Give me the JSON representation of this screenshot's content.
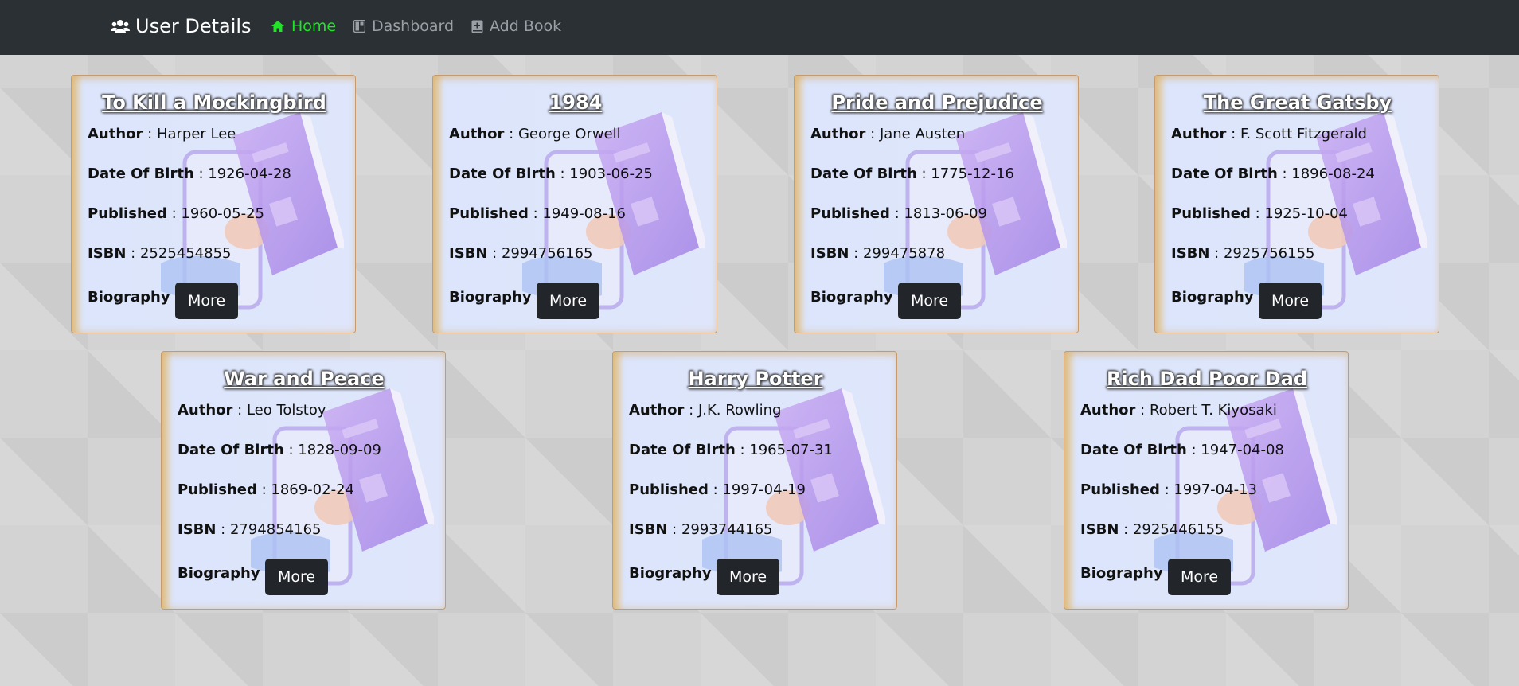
{
  "navbar": {
    "brand": "User Details",
    "links": [
      {
        "label": "Home",
        "icon": "home-icon",
        "active": true
      },
      {
        "label": "Dashboard",
        "icon": "dashboard-icon",
        "active": false
      },
      {
        "label": "Add Book",
        "icon": "add-book-icon",
        "active": false
      }
    ]
  },
  "labels": {
    "author": "Author",
    "dob": "Date Of Birth",
    "published": "Published",
    "isbn": "ISBN",
    "biography": "Biography",
    "more": "More"
  },
  "books": [
    {
      "title": "To Kill a Mockingbird",
      "author": "Harper Lee",
      "dob": "1926-04-28",
      "published": "1960-05-25",
      "isbn": "2525454855"
    },
    {
      "title": "1984",
      "author": "George Orwell",
      "dob": "1903-06-25",
      "published": "1949-08-16",
      "isbn": "2994756165"
    },
    {
      "title": "Pride and Prejudice",
      "author": "Jane Austen",
      "dob": "1775-12-16",
      "published": "1813-06-09",
      "isbn": "299475878"
    },
    {
      "title": "The Great Gatsby",
      "author": "F. Scott Fitzgerald",
      "dob": "1896-08-24",
      "published": "1925-10-04",
      "isbn": "2925756155"
    },
    {
      "title": "War and Peace",
      "author": "Leo Tolstoy",
      "dob": "1828-09-09",
      "published": "1869-02-24",
      "isbn": "2794854165"
    },
    {
      "title": "Harry Potter",
      "author": "J.K. Rowling",
      "dob": "1965-07-31",
      "published": "1997-04-19",
      "isbn": "2993744165"
    },
    {
      "title": "Rich Dad Poor Dad",
      "author": "Robert T. Kiyosaki",
      "dob": "1947-04-08",
      "published": "1997-04-13",
      "isbn": "2925446155"
    }
  ],
  "colors": {
    "navbar": "#2b3035",
    "active_link": "#22e22a",
    "inactive_link": "#9aa0a6",
    "button": "#22262b",
    "background": "#d3d3d3"
  }
}
